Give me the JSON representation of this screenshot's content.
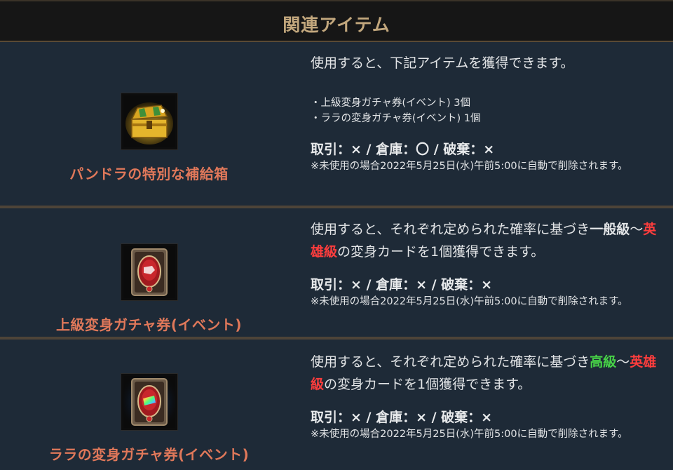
{
  "header": {
    "title": "関連アイテム"
  },
  "items": [
    {
      "name": "パンドラの特別な補給箱",
      "icon": "treasure-chest-icon",
      "desc": "使用すると、下記アイテムを獲得できます。",
      "list": [
        "・上級変身ガチャ券(イベント) 3個",
        "・ララの変身ガチャ券(イベント) 1個"
      ],
      "trade": "取引：× / 倉庫：〇 / 破棄：×",
      "note": "※未使用の場合2022年5月25日(水)午前5:00に自動で削除されます。"
    },
    {
      "name": "上級変身ガチャ券(イベント)",
      "icon": "transformation-card-red-icon",
      "desc_parts": [
        "使用すると、それぞれ定められた確率に基づき",
        "一般級",
        "〜",
        "英雄級",
        "の変身カードを1個獲得できます。"
      ],
      "trade": "取引：× / 倉庫：× / 破棄：×",
      "note": "※未使用の場合2022年5月25日(水)午前5:00に自動で削除されます。"
    },
    {
      "name": "ララの変身ガチャ券(イベント)",
      "icon": "transformation-card-rainbow-icon",
      "desc_parts": [
        "使用すると、それぞれ定められた確率に基づき",
        "高級",
        "〜",
        "英雄級",
        "の変身カードを1個獲得できます。"
      ],
      "trade": "取引：× / 倉庫：× / 破棄：×",
      "note": "※未使用の場合2022年5月25日(水)午前5:00に自動で削除されます。"
    }
  ],
  "colors": {
    "header_text": "#c2a77d",
    "item_name": "#e0785a",
    "hero_grade": "#ff3d3d",
    "high_grade": "#47d247",
    "background": "#1e2a37"
  }
}
